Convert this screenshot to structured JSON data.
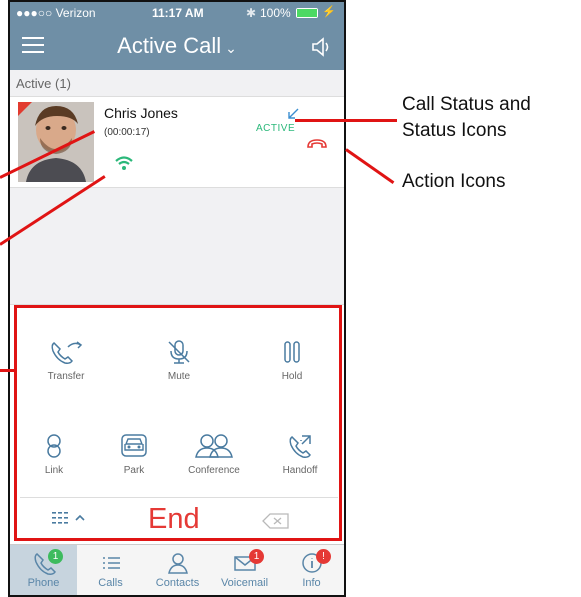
{
  "status_bar": {
    "carrier": "●●●○○ Verizon",
    "time": "11:17 AM",
    "battery": "100%"
  },
  "navbar": {
    "title": "Active Call"
  },
  "section": {
    "label": "Active (1)"
  },
  "call": {
    "name": "Chris Jones",
    "timer": "(00:00:17)",
    "status": "ACTIVE"
  },
  "controls": {
    "transfer": "Transfer",
    "mute": "Mute",
    "hold": "Hold",
    "link": "Link",
    "park": "Park",
    "conference": "Conference",
    "handoff": "Handoff",
    "end": "End"
  },
  "tabs": [
    {
      "label": "Phone",
      "badge": "1"
    },
    {
      "label": "Calls"
    },
    {
      "label": "Contacts"
    },
    {
      "label": "Voicemail",
      "badge": "1"
    },
    {
      "label": "Info",
      "badge": "!"
    }
  ],
  "annotations": {
    "call_status": [
      "Call Status and",
      "Status Icons"
    ],
    "action_icons": "Action Icons"
  },
  "colors": {
    "header": "#6f8fa6",
    "active_green": "#2bb87a",
    "end_red": "#e53935",
    "badge_green": "#3dbb5e",
    "badge_red": "#e53935",
    "annotation_red": "#e01414"
  }
}
